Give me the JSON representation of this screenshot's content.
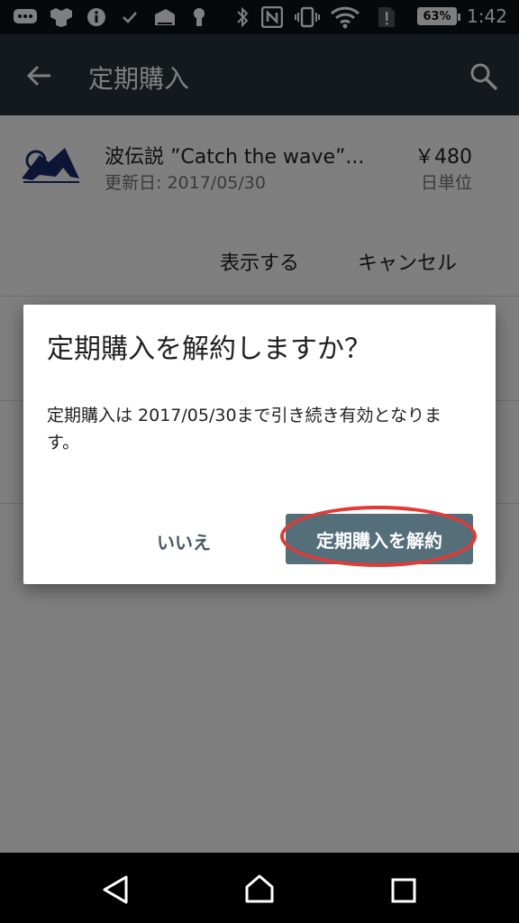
{
  "status_bar": {
    "battery": "63%",
    "time": "1:42"
  },
  "app_bar": {
    "title": "定期購入",
    "back_icon": "arrow-left-icon",
    "search_icon": "search-icon"
  },
  "subscription": {
    "title": "波伝説 ”Catch the wave”...",
    "date": "更新日: 2017/05/30",
    "price": "￥480",
    "unit": "日単位",
    "view_label": "表示する",
    "cancel_label": "キャンセル"
  },
  "dialog": {
    "title": "定期購入を解約しますか？",
    "message": "定期購入は 2017/05/30まで引き続き有効となります。",
    "no_label": "いいえ",
    "confirm_label": "定期購入を解約",
    "highlight_color": "#e53935"
  },
  "nav_bar": {
    "back": "back-triangle-icon",
    "home": "home-icon",
    "recents": "recents-square-icon"
  }
}
